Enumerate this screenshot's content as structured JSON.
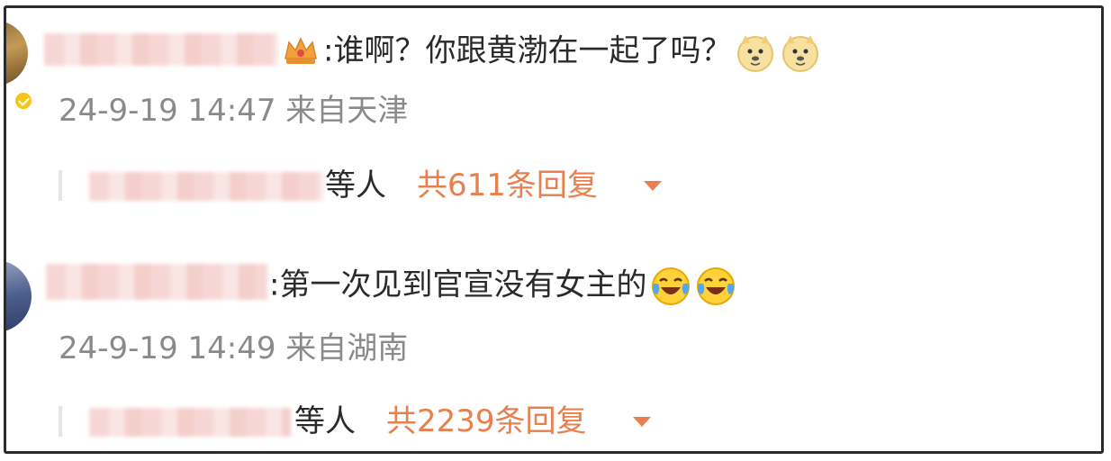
{
  "comments": [
    {
      "text": ":谁啊？你跟黄渤在一起了吗？",
      "emojis": [
        "doge-emoji",
        "doge-emoji"
      ],
      "timestamp": "24-9-19 14:47 来自天津",
      "reply_suffix": "等人",
      "reply_count": "共611条回复"
    },
    {
      "text": ":第一次见到官宣没有女主的",
      "emojis": [
        "laugh-cry-emoji",
        "laugh-cry-emoji"
      ],
      "timestamp": "24-9-19 14:49 来自湖南",
      "reply_suffix": "等人",
      "reply_count": "共2239条回复"
    }
  ],
  "colors": {
    "text": "#2a2a2a",
    "meta": "#8a8a8a",
    "accent": "#e8804e",
    "badge": "#f5c518"
  }
}
